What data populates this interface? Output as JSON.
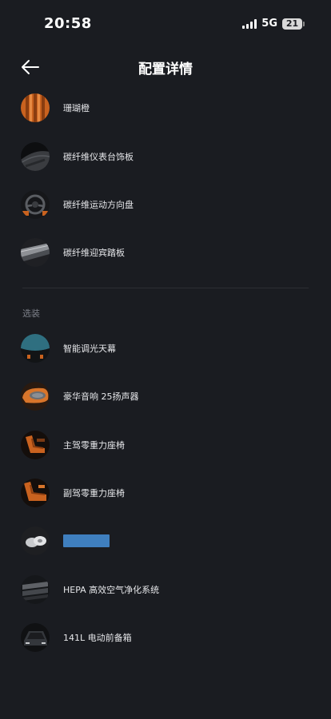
{
  "status_bar": {
    "time": "20:58",
    "network": "5G",
    "battery": "21"
  },
  "header": {
    "title": "配置详情"
  },
  "items": [
    {
      "label": "珊瑚橙",
      "icon": "coral-orange-swatch-icon"
    },
    {
      "label": "碳纤维仪表台饰板",
      "icon": "carbon-dashboard-trim-icon"
    },
    {
      "label": "碳纤维运动方向盘",
      "icon": "carbon-steering-wheel-icon"
    },
    {
      "label": "碳纤维迎宾踏板",
      "icon": "carbon-door-sill-icon"
    }
  ],
  "optional": {
    "title": "选装",
    "items": [
      {
        "label": "智能调光天幕",
        "icon": "smart-dimming-roof-icon"
      },
      {
        "label": "豪华音响 25扬声器",
        "icon": "premium-speaker-icon"
      },
      {
        "label": "主驾零重力座椅",
        "icon": "driver-zero-gravity-seat-icon"
      },
      {
        "label": "副驾零重力座椅",
        "icon": "passenger-zero-gravity-seat-icon"
      },
      {
        "label": "",
        "icon": "wheel-icon"
      },
      {
        "label": "HEPA 高效空气净化系统",
        "icon": "hepa-filter-icon"
      },
      {
        "label": "141L 电动前备箱",
        "icon": "front-trunk-icon"
      }
    ]
  },
  "colors": {
    "background": "#1a1c21",
    "accent_orange": "#e07a2e",
    "redaction": "#3f7fbf"
  }
}
